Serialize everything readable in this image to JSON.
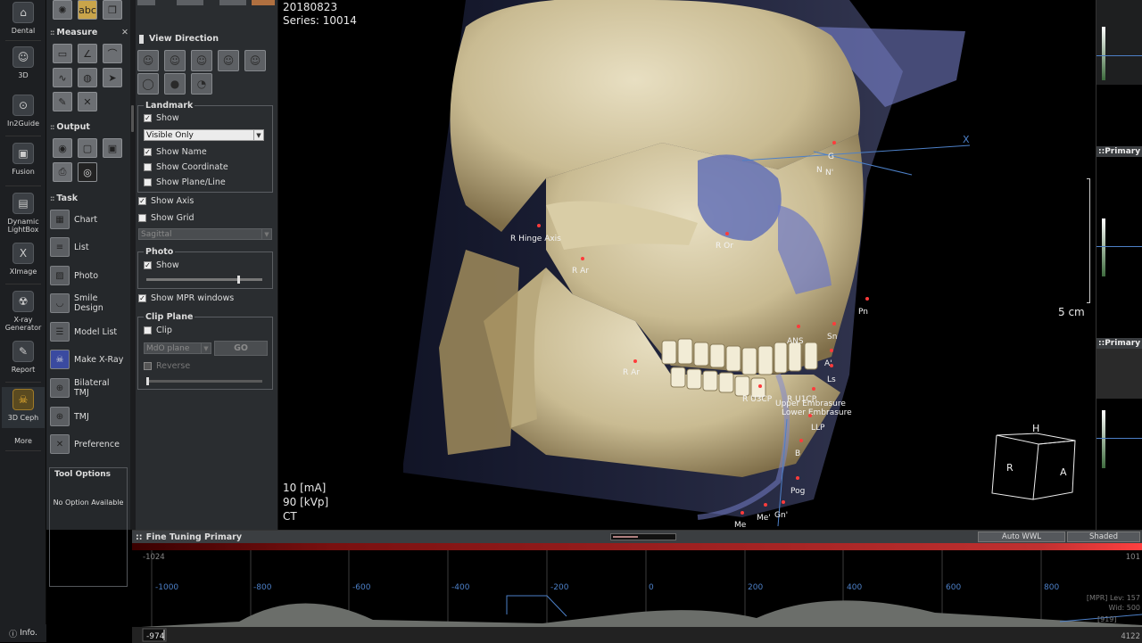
{
  "nav": {
    "items": [
      {
        "label": "Dental",
        "icon": "tooth-icon"
      },
      {
        "label": "3D",
        "icon": "head-3d-icon"
      },
      {
        "label": "In2Guide",
        "icon": "guide-icon"
      },
      {
        "label": "Fusion",
        "icon": "fusion-icon"
      },
      {
        "label": "Dynamic LightBox",
        "icon": "lightbox-icon"
      },
      {
        "label": "XImage",
        "icon": "ximage-icon"
      },
      {
        "label": "X-ray Generator",
        "icon": "xray-generator-icon"
      },
      {
        "label": "Report",
        "icon": "report-icon"
      },
      {
        "label": "3D Ceph",
        "icon": "ceph-3d-icon"
      }
    ],
    "more": "More",
    "info": "Info."
  },
  "tools": {
    "measure_title": "Measure",
    "output_title": "Output",
    "task_title": "Task",
    "tasks": [
      "Chart",
      "List",
      "Photo",
      "Smile Design",
      "Model List",
      "Make X-Ray",
      "Bilateral TMJ",
      "TMJ",
      "Preference"
    ],
    "tool_options_title": "Tool Options",
    "tool_options_text": "No Option Available"
  },
  "panel": {
    "view_direction": "View Direction",
    "landmark": {
      "title": "Landmark",
      "show": "Show",
      "visibility": "Visible Only",
      "show_name": "Show Name",
      "show_coordinate": "Show Coordinate",
      "show_plane_line": "Show Plane/Line"
    },
    "show_axis": "Show Axis",
    "show_grid": "Show Grid",
    "grid_plane": "Sagittal",
    "photo": {
      "title": "Photo",
      "show": "Show"
    },
    "show_mpr": "Show MPR windows",
    "clip": {
      "title": "Clip Plane",
      "clip": "Clip",
      "plane": "MdO plane",
      "go": "GO",
      "reverse": "Reverse"
    }
  },
  "viewport": {
    "date": "20180823",
    "series": "Series: 10014",
    "ma": "10 [mA]",
    "kvp": "90 [kVp]",
    "modality": "CT",
    "scale": "5 cm",
    "axis_x": "X",
    "cube": {
      "top": "H",
      "left": "R",
      "right": "A"
    },
    "landmarks": [
      "G",
      "N",
      "N'",
      "R Hinge Axis",
      "R Or",
      "R Ar",
      "Pn",
      "ANS",
      "Sn",
      "A'",
      "Ls",
      "R Ar",
      "R U3CP",
      "R U1CP",
      "Upper Embrasure",
      "Lower Embrasure",
      "LLP",
      "B",
      "Pog",
      "Me'",
      "Gn'",
      "Me"
    ]
  },
  "right_strip": {
    "labels": [
      "Primary",
      "Primary"
    ]
  },
  "finetune": {
    "title": "Fine Tuning Primary",
    "auto_wwl": "Auto WWL",
    "shaded": "Shaded",
    "min_label": "-1024",
    "max_label": "101",
    "ticks": [
      "-1000",
      "-800",
      "-600",
      "-400",
      "-200",
      "0",
      "200",
      "400",
      "600",
      "800"
    ],
    "current_value": "-974",
    "max_value": "4122",
    "mpr_lev": "[MPR] Lev: 157",
    "mpr_wid": "Wid: 500",
    "mpr_val": "[919]"
  },
  "colors": {
    "accent": "#f1b430",
    "histogram": "#6b6e6a",
    "landmark": "#ff3b3b"
  }
}
